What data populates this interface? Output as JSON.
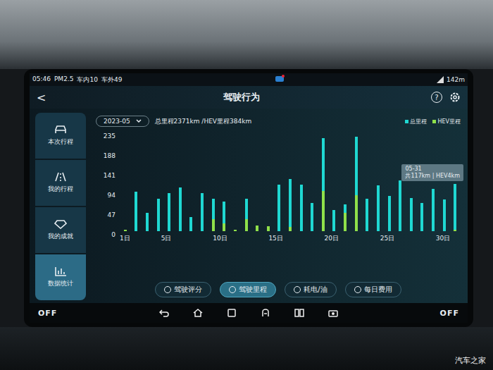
{
  "status_bar": {
    "time": "05:46",
    "pm": "PM2.5",
    "inside": "车内10",
    "outside": "车外49",
    "signal": "142m"
  },
  "header": {
    "back": "<",
    "title": "驾驶行为",
    "help": "?"
  },
  "sidebar": {
    "items": [
      {
        "label": "本次行程",
        "selected": false
      },
      {
        "label": "我的行程",
        "selected": false
      },
      {
        "label": "我的成就",
        "selected": false
      },
      {
        "label": "数据统计",
        "selected": true
      }
    ]
  },
  "toolbar": {
    "month": "2023-05",
    "summary": "总里程2371km /HEV里程384km"
  },
  "chart": {
    "y_ticks": [
      "235",
      "188",
      "141",
      "94",
      "47",
      "0"
    ],
    "y_max": 235,
    "x_ticks": [
      "1日",
      "5日",
      "10日",
      "15日",
      "20日",
      "25日",
      "30日"
    ],
    "series": [
      {
        "name": "总里程",
        "color": "#1fd8d2",
        "values": [
          3,
          98,
          46,
          81,
          95,
          109,
          35,
          95,
          81,
          74,
          4,
          81,
          14,
          12,
          116,
          130,
          116,
          70,
          232,
          53,
          67,
          235,
          81,
          114,
          88,
          126,
          83,
          70,
          105,
          79,
          117
        ]
      },
      {
        "name": "HEV里程",
        "color": "#8fe04a",
        "values": [
          3,
          0,
          0,
          0,
          0,
          0,
          0,
          0,
          30,
          20,
          4,
          30,
          14,
          12,
          0,
          10,
          0,
          0,
          100,
          0,
          45,
          90,
          0,
          0,
          0,
          0,
          0,
          0,
          0,
          0,
          4
        ]
      }
    ],
    "tooltip": {
      "date": "05-31",
      "text": "共117km | HEV4km"
    }
  },
  "tabs": [
    {
      "label": "驾驶评分",
      "selected": false
    },
    {
      "label": "驾驶里程",
      "selected": true
    },
    {
      "label": "耗电/油",
      "selected": false
    },
    {
      "label": "每日费用",
      "selected": false
    }
  ],
  "navbar": {
    "left": "OFF",
    "right": "OFF"
  },
  "watermark": "汽车之家"
}
